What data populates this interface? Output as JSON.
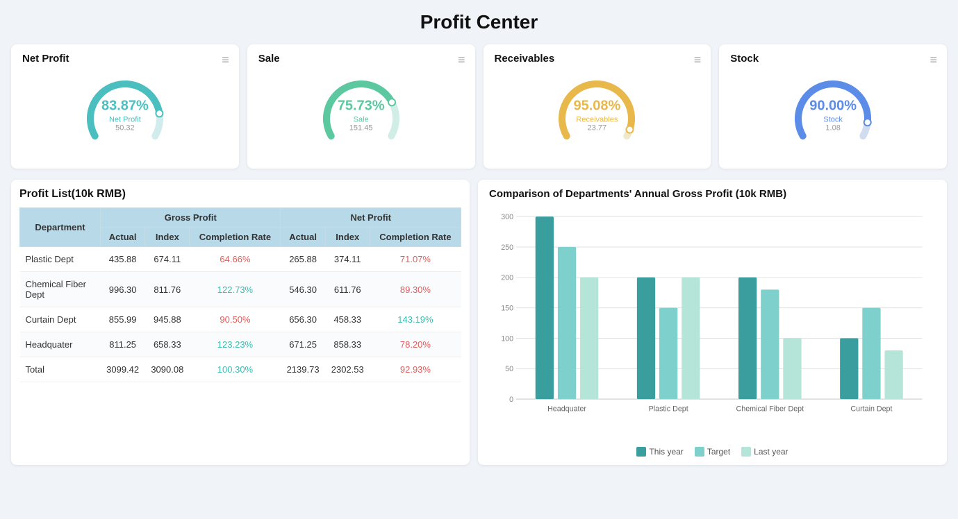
{
  "page": {
    "title": "Profit Center"
  },
  "cards": [
    {
      "id": "net-profit",
      "title": "Net Profit",
      "percent": "83.87%",
      "label": "Net Profit",
      "value": "50.32",
      "color": "#4bbfbf",
      "bg_color": "#e0f5f5",
      "track_color": "#d0ecec"
    },
    {
      "id": "sale",
      "title": "Sale",
      "percent": "75.73%",
      "label": "Sale",
      "value": "151.45",
      "color": "#5bc8a0",
      "bg_color": "#e3f7ef",
      "track_color": "#d0eee6"
    },
    {
      "id": "receivables",
      "title": "Receivables",
      "percent": "95.08%",
      "label": "Receivables",
      "value": "23.77",
      "color": "#e8b84b",
      "bg_color": "#fdf5e0",
      "track_color": "#f0e8cc"
    },
    {
      "id": "stock",
      "title": "Stock",
      "percent": "90.00%",
      "label": "Stock",
      "value": "1.08",
      "color": "#5b8ce8",
      "bg_color": "#e8eef8",
      "track_color": "#d0dcf0"
    }
  ],
  "profit_list": {
    "title": "Profit List(10k RMB)",
    "headers": {
      "department": "Department",
      "gross_profit": "Gross Profit",
      "net_profit": "Net Profit",
      "actual": "Actual",
      "index": "Index",
      "completion_rate": "Completion Rate"
    },
    "rows": [
      {
        "department": "Plastic Dept",
        "gp_actual": "435.88",
        "gp_index": "674.11",
        "gp_rate": "64.66%",
        "gp_rate_color": "red",
        "np_actual": "265.88",
        "np_index": "374.11",
        "np_rate": "71.07%",
        "np_rate_color": "red"
      },
      {
        "department": "Chemical Fiber\nDept",
        "gp_actual": "996.30",
        "gp_index": "811.76",
        "gp_rate": "122.73%",
        "gp_rate_color": "green",
        "np_actual": "546.30",
        "np_index": "611.76",
        "np_rate": "89.30%",
        "np_rate_color": "red"
      },
      {
        "department": "Curtain Dept",
        "gp_actual": "855.99",
        "gp_index": "945.88",
        "gp_rate": "90.50%",
        "gp_rate_color": "red",
        "np_actual": "656.30",
        "np_index": "458.33",
        "np_rate": "143.19%",
        "np_rate_color": "green"
      },
      {
        "department": "Headquater",
        "gp_actual": "811.25",
        "gp_index": "658.33",
        "gp_rate": "123.23%",
        "gp_rate_color": "green",
        "np_actual": "671.25",
        "np_index": "858.33",
        "np_rate": "78.20%",
        "np_rate_color": "red"
      },
      {
        "department": "Total",
        "gp_actual": "3099.42",
        "gp_index": "3090.08",
        "gp_rate": "100.30%",
        "gp_rate_color": "green",
        "np_actual": "2139.73",
        "np_index": "2302.53",
        "np_rate": "92.93%",
        "np_rate_color": "red"
      }
    ]
  },
  "bar_chart": {
    "title": "Comparison of Departments' Annual Gross Profit (10k RMB)",
    "y_max": 300,
    "y_labels": [
      "0",
      "50",
      "100",
      "150",
      "200",
      "250",
      "300"
    ],
    "groups": [
      {
        "label": "Headquater",
        "this_year": 300,
        "target": 250,
        "last_year": 200
      },
      {
        "label": "Plastic Dept",
        "this_year": 200,
        "target": 150,
        "last_year": 200
      },
      {
        "label": "Chemical Fiber Dept",
        "this_year": 200,
        "target": 180,
        "last_year": 100
      },
      {
        "label": "Curtain Dept",
        "this_year": 100,
        "target": 150,
        "last_year": 80
      }
    ],
    "legend": [
      {
        "label": "This year",
        "color": "#3a9e9e"
      },
      {
        "label": "Target",
        "color": "#7dd0cc"
      },
      {
        "label": "Last year",
        "color": "#b5e5d8"
      }
    ],
    "colors": {
      "this_year": "#3a9e9e",
      "target": "#7dd0cc",
      "last_year": "#b5e5d8"
    }
  }
}
